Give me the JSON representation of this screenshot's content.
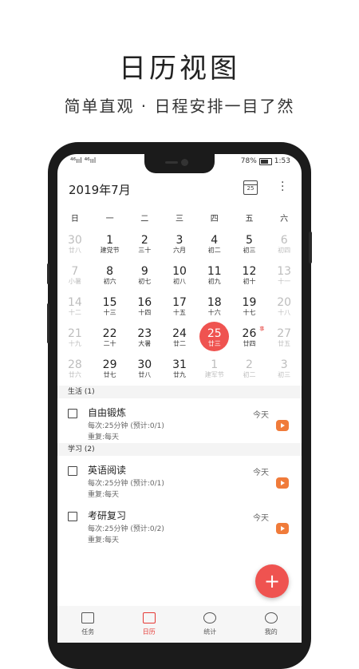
{
  "promo": {
    "title": "日历视图",
    "subtitle": "简单直观 · 日程安排一目了然"
  },
  "status_bar": {
    "left": "⁴⁶ııl ⁴⁶ııl",
    "battery": "78%",
    "time": "1:53"
  },
  "header": {
    "month": "2019年7月",
    "calendar_icon_day": "25"
  },
  "weekdays": [
    "日",
    "一",
    "二",
    "三",
    "四",
    "五",
    "六"
  ],
  "weeks": [
    [
      {
        "d": "30",
        "l": "廿八"
      },
      {
        "d": "1",
        "l": "建党节"
      },
      {
        "d": "2",
        "l": "三十"
      },
      {
        "d": "3",
        "l": "六月"
      },
      {
        "d": "4",
        "l": "初二"
      },
      {
        "d": "5",
        "l": "初三"
      },
      {
        "d": "6",
        "l": "初四"
      }
    ],
    [
      {
        "d": "7",
        "l": "小暑"
      },
      {
        "d": "8",
        "l": "初六"
      },
      {
        "d": "9",
        "l": "初七"
      },
      {
        "d": "10",
        "l": "初八"
      },
      {
        "d": "11",
        "l": "初九"
      },
      {
        "d": "12",
        "l": "初十"
      },
      {
        "d": "13",
        "l": "十一"
      }
    ],
    [
      {
        "d": "14",
        "l": "十二"
      },
      {
        "d": "15",
        "l": "十三"
      },
      {
        "d": "16",
        "l": "十四"
      },
      {
        "d": "17",
        "l": "十五"
      },
      {
        "d": "18",
        "l": "十六"
      },
      {
        "d": "19",
        "l": "十七"
      },
      {
        "d": "20",
        "l": "十八"
      }
    ],
    [
      {
        "d": "21",
        "l": "十九"
      },
      {
        "d": "22",
        "l": "二十"
      },
      {
        "d": "23",
        "l": "大暑"
      },
      {
        "d": "24",
        "l": "廿二"
      },
      {
        "d": "25",
        "l": "廿三",
        "tag": "事"
      },
      {
        "d": "26",
        "l": "廿四",
        "tag": "事"
      },
      {
        "d": "27",
        "l": "廿五"
      }
    ],
    [
      {
        "d": "28",
        "l": "廿六"
      },
      {
        "d": "29",
        "l": "廿七"
      },
      {
        "d": "30",
        "l": "廿八"
      },
      {
        "d": "31",
        "l": "廿九"
      },
      {
        "d": "1",
        "l": "建军节"
      },
      {
        "d": "2",
        "l": "初二"
      },
      {
        "d": "3",
        "l": "初三"
      }
    ]
  ],
  "dim_cells": [
    "0-0",
    "0-6",
    "1-0",
    "1-6",
    "2-0",
    "2-6",
    "3-0",
    "3-6",
    "4-0",
    "4-4",
    "4-5",
    "4-6"
  ],
  "today_cell": "3-4",
  "sections": [
    {
      "title": "生活 (1)",
      "tasks": [
        {
          "title": "自由锻炼",
          "meta1": "每次:25分钟 (预计:0/1)",
          "meta2": "重复:每天",
          "when": "今天"
        }
      ]
    },
    {
      "title": "学习 (2)",
      "tasks": [
        {
          "title": "英语阅读",
          "meta1": "每次:25分钟 (预计:0/1)",
          "meta2": "重复:每天",
          "when": "今天"
        },
        {
          "title": "考研复习",
          "meta1": "每次:25分钟 (预计:0/2)",
          "meta2": "重复:每天",
          "when": "今天"
        }
      ]
    }
  ],
  "fab": "+",
  "tabs": [
    {
      "label": "任务",
      "icon": "task-list-icon"
    },
    {
      "label": "日历",
      "icon": "calendar-icon",
      "active": true
    },
    {
      "label": "统计",
      "icon": "pie-chart-icon"
    },
    {
      "label": "我的",
      "icon": "person-icon"
    }
  ],
  "colors": {
    "accent": "#ef5350",
    "play": "#f07b3a"
  }
}
